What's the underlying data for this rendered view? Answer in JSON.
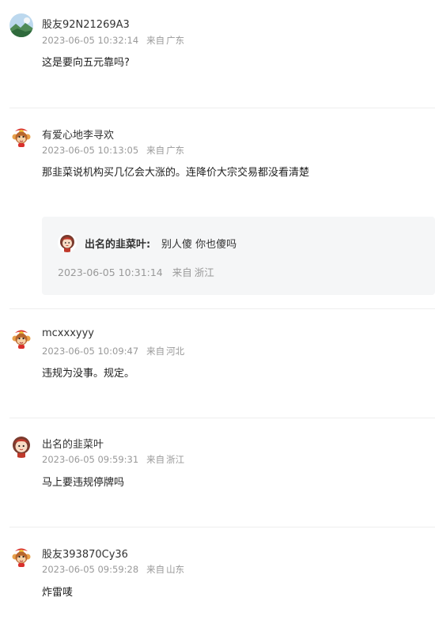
{
  "comments": [
    {
      "avatar_icon": "landscape-avatar-icon",
      "username": "股友92N21269A3",
      "time": "2023-06-05 10:32:14",
      "from_label": "来自",
      "location": "广东",
      "text": "这是要向五元靠吗?"
    },
    {
      "avatar_icon": "monkey-mascot-avatar-icon",
      "username": "有爱心地李寻欢",
      "time": "2023-06-05 10:13:05",
      "from_label": "来自",
      "location": "广东",
      "text": "那韭菜说机构买几亿会大涨的。连降价大宗交易都没看清楚",
      "reply": {
        "avatar_icon": "girl-avatar-icon",
        "name": "出名的韭菜叶:",
        "text": "别人傻 你也傻吗",
        "time": "2023-06-05 10:31:14",
        "from_label": "来自",
        "location": "浙江"
      }
    },
    {
      "avatar_icon": "monkey-mascot-avatar-icon",
      "username": "mcxxxyyy",
      "time": "2023-06-05 10:09:47",
      "from_label": "来自",
      "location": "河北",
      "text": "违规为没事。规定。"
    },
    {
      "avatar_icon": "girl-avatar-icon",
      "username": "出名的韭菜叶",
      "time": "2023-06-05 09:59:31",
      "from_label": "来自",
      "location": "浙江",
      "text": "马上要违规停牌吗"
    },
    {
      "avatar_icon": "monkey-mascot-avatar-icon",
      "username": "股友393870Cy36",
      "time": "2023-06-05 09:59:28",
      "from_label": "来自",
      "location": "山东",
      "text": "炸雷唛"
    }
  ]
}
